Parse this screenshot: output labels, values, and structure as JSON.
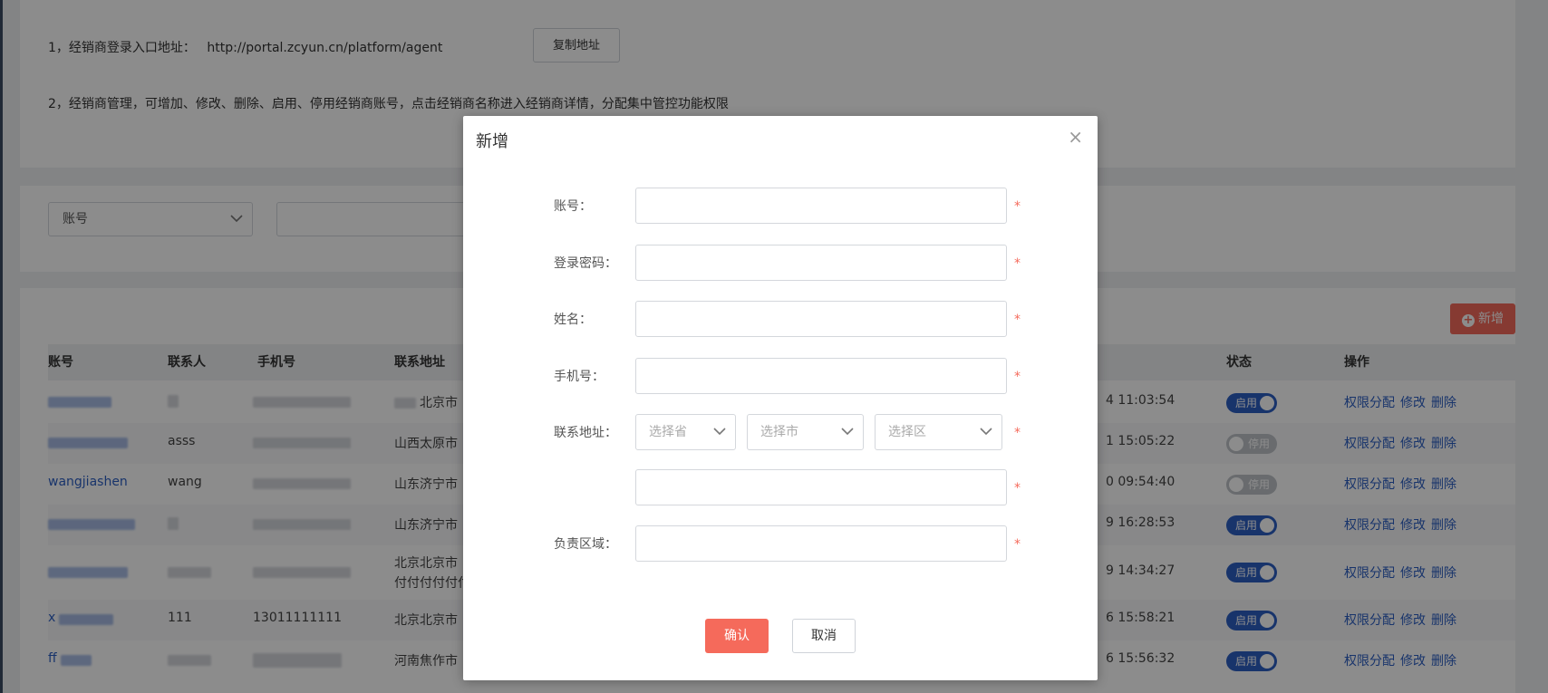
{
  "info": {
    "line1_label": "1，经销商登录入口地址：",
    "line1_url": "http://portal.zcyun.cn/platform/agent",
    "copy_button": "复制地址",
    "line2": "2，经销商管理，可增加、修改、删除、启用、停用经销商账号，点击经销商名称进入经销商详情，分配集中管控功能权限"
  },
  "search": {
    "field_select_value": "账号"
  },
  "table": {
    "add_button": "新增",
    "columns": [
      "账号",
      "联系人",
      "手机号",
      "联系地址",
      "状态",
      "操作"
    ],
    "rows": [
      {
        "contact": "",
        "address": "北京市",
        "time": "4 11:03:54",
        "status": "启用",
        "on": true
      },
      {
        "contact": "asss",
        "address": "山西太原市",
        "time": "1 15:05:22",
        "status": "停用",
        "on": false
      },
      {
        "account": "wangjiashen",
        "contact": "wang",
        "address": "山东济宁市",
        "time": "0 09:54:40",
        "status": "停用",
        "on": false
      },
      {
        "contact": "",
        "address": "山东济宁市",
        "time": "9 16:28:53",
        "status": "启用",
        "on": true
      },
      {
        "contact": "",
        "address": "北京北京市",
        "address2": "付付付付付付",
        "time": "9 14:34:27",
        "status": "启用",
        "on": true
      },
      {
        "account": "x",
        "contact": "111",
        "phone": "13011111111",
        "address": "北京北京市",
        "time": "6 15:58:21",
        "status": "启用",
        "on": true
      },
      {
        "account": "ff",
        "contact": "",
        "address": "河南焦作市",
        "time": "6 15:56:32",
        "status": "启用",
        "on": true
      }
    ],
    "ops": [
      "权限分配",
      "修改",
      "删除"
    ]
  },
  "modal": {
    "title": "新增",
    "close_icon": "×",
    "labels": {
      "account": "账号：",
      "password": "登录密码：",
      "name": "姓名：",
      "phone": "手机号：",
      "address": "联系地址：",
      "region": "负责区域："
    },
    "required_mark": "*",
    "province_placeholder": "选择省",
    "city_placeholder": "选择市",
    "district_placeholder": "选择区",
    "confirm": "确认",
    "cancel": "取消"
  },
  "colors": {
    "accent": "#f56a5b",
    "link": "#2d5fc4",
    "toggle_on": "#2d5fc4",
    "toggle_off": "#bfc3c9"
  }
}
